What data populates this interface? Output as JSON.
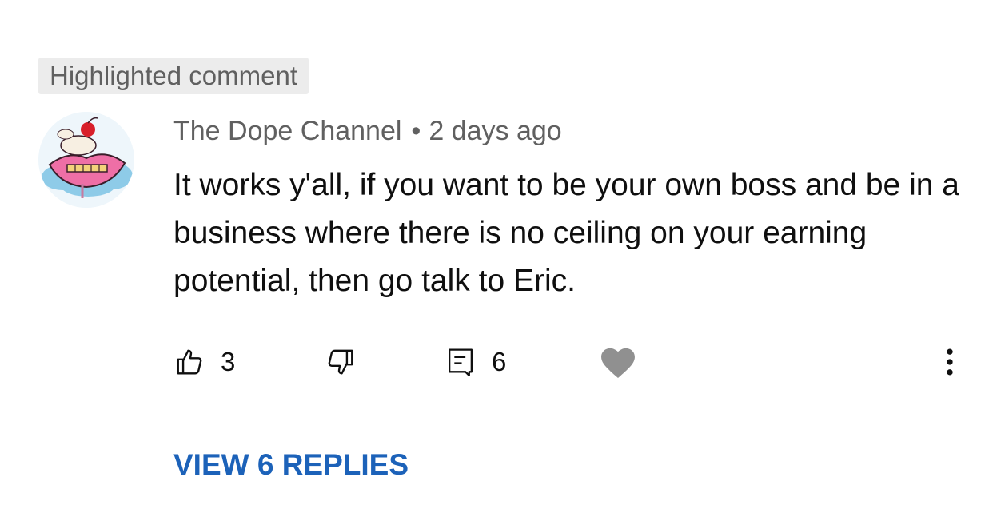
{
  "badge": "Highlighted comment",
  "comment": {
    "author": "The Dope Channel",
    "separator": "•",
    "time": "2 days ago",
    "text": "It works y'all, if you want to be your own boss and be in a business where there is no ceiling on your earning potential, then go talk to Eric."
  },
  "actions": {
    "likes": "3",
    "replies_count": "6",
    "icons": [
      "thumbs-up-icon",
      "thumbs-down-icon",
      "reply-icon",
      "heart-icon",
      "more-vertical-icon"
    ]
  },
  "view_replies": "VIEW 6 REPLIES",
  "colors": {
    "link": "#1c62b9",
    "secondary_text": "#606060",
    "badge_bg": "#ececec",
    "heart": "#909090"
  }
}
